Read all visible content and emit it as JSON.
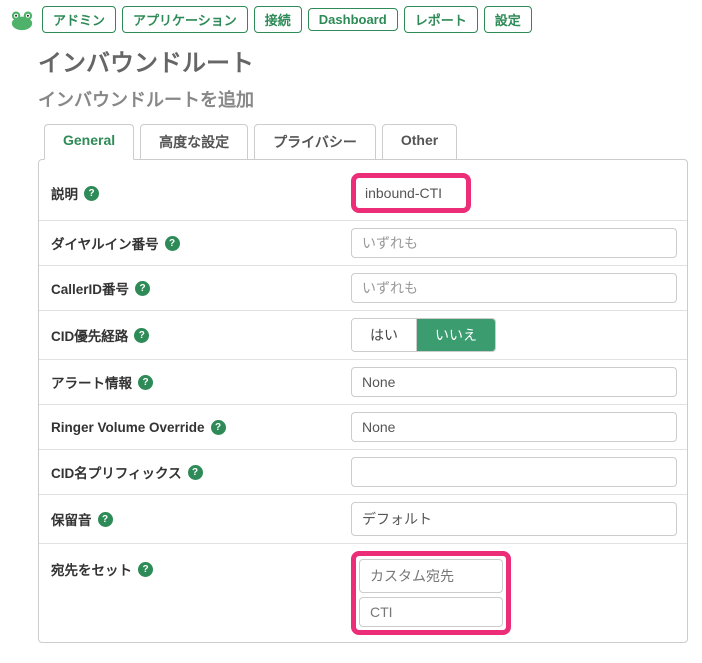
{
  "nav": {
    "items": [
      "アドミン",
      "アプリケーション",
      "接続",
      "Dashboard",
      "レポート",
      "設定"
    ]
  },
  "page": {
    "title": "インバウンドルート",
    "subtitle": "インバウンドルートを追加"
  },
  "tabs": {
    "items": [
      "General",
      "高度な設定",
      "プライバシー",
      "Other"
    ],
    "active": 0
  },
  "form": {
    "description": {
      "label": "説明",
      "value": "inbound-CTI"
    },
    "did": {
      "label": "ダイヤルイン番号",
      "placeholder": "いずれも",
      "value": ""
    },
    "callerid": {
      "label": "CallerID番号",
      "placeholder": "いずれも",
      "value": ""
    },
    "cid_priority": {
      "label": "CID優先経路",
      "options": [
        "はい",
        "いいえ"
      ],
      "selected": 1
    },
    "alert_info": {
      "label": "アラート情報",
      "value": "None"
    },
    "ringer_vol": {
      "label": "Ringer Volume Override",
      "value": "None"
    },
    "cid_prefix": {
      "label": "CID名プリフィックス",
      "value": ""
    },
    "moh": {
      "label": "保留音",
      "value": "デフォルト"
    },
    "destination": {
      "label": "宛先をセット",
      "top": "カスタム宛先",
      "bottom": "CTI"
    }
  }
}
